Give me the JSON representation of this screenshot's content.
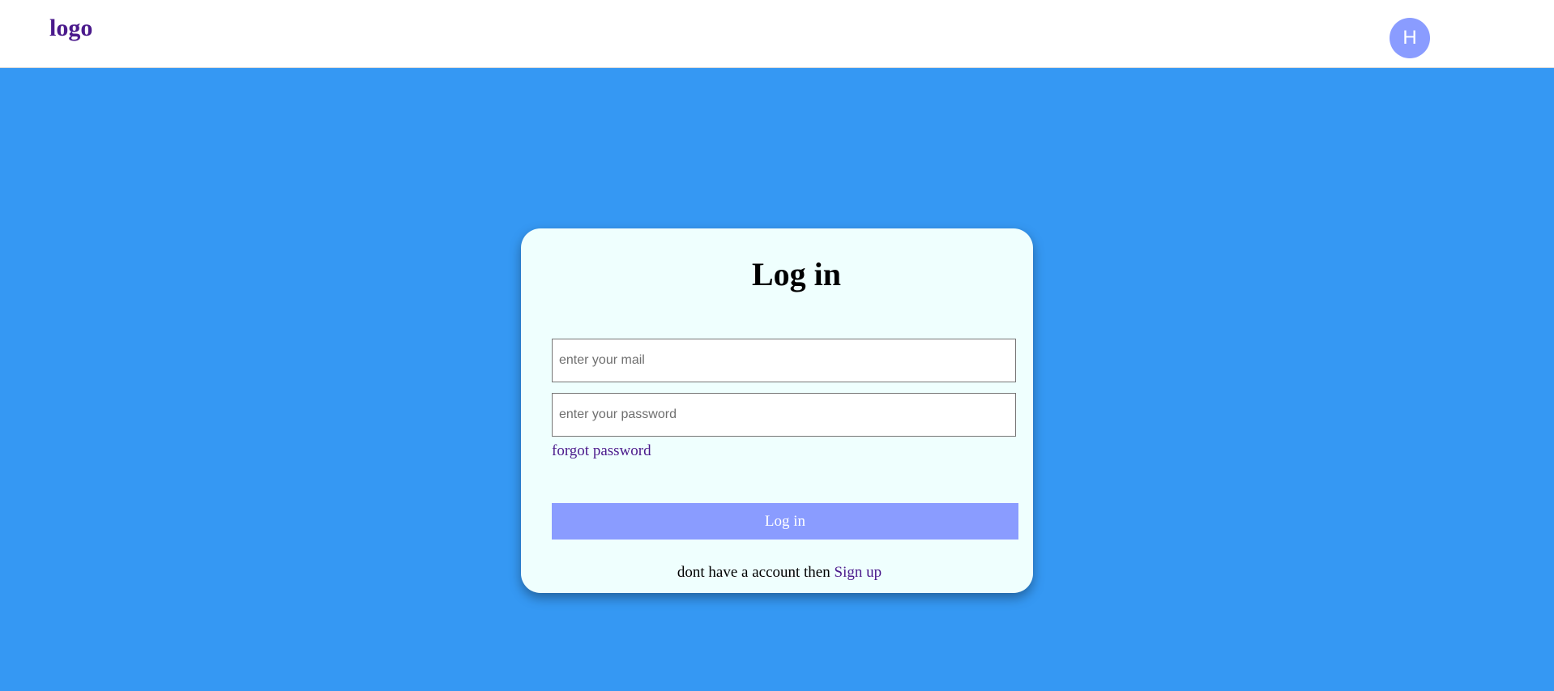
{
  "navbar": {
    "logo_text": "logo",
    "avatar_initial": "H"
  },
  "login_card": {
    "title": "Log in",
    "email": {
      "placeholder": "enter your mail",
      "value": ""
    },
    "password": {
      "placeholder": "enter your password",
      "value": ""
    },
    "forgot_label": "forgot password",
    "submit_label": "Log in",
    "signup_prompt": "dont have a account then",
    "signup_link_label": "Sign up"
  },
  "colors": {
    "page_background": "#3598f3",
    "navbar_background": "#ffffff",
    "card_background": "#effffe",
    "accent": "#8a9cff",
    "link": "#4b1a8c"
  }
}
